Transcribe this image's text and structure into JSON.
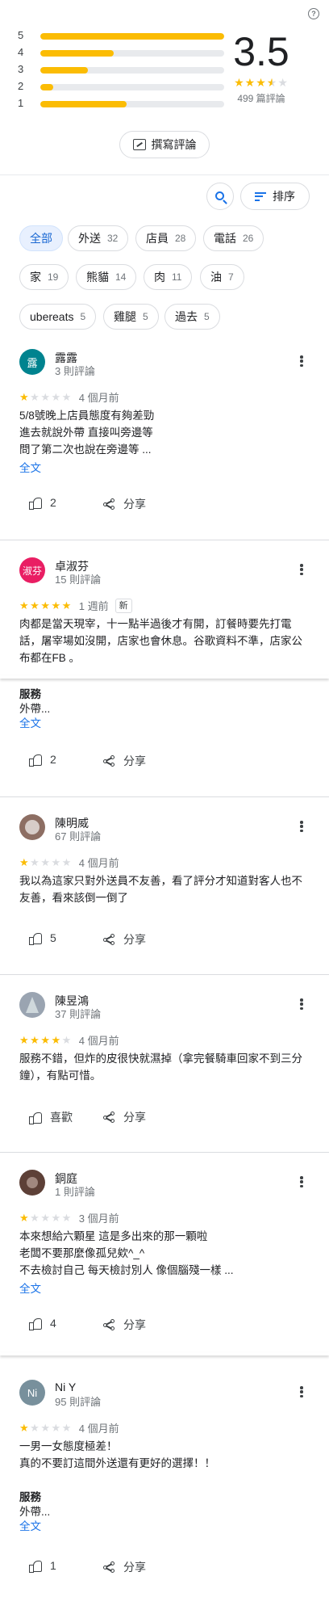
{
  "summary": {
    "rating": "3.5",
    "review_count": "499 篇評論",
    "distribution": [
      {
        "stars": "5",
        "fraction": 1.0
      },
      {
        "stars": "4",
        "fraction": 0.4
      },
      {
        "stars": "3",
        "fraction": 0.26
      },
      {
        "stars": "2",
        "fraction": 0.07
      },
      {
        "stars": "1",
        "fraction": 0.47
      }
    ]
  },
  "write_review_label": "撰寫評論",
  "sort_label": "排序",
  "chips": [
    {
      "label": "全部",
      "count": ""
    },
    {
      "label": "外送",
      "count": "32"
    },
    {
      "label": "店員",
      "count": "28"
    },
    {
      "label": "電話",
      "count": "26"
    },
    {
      "label": "家",
      "count": "19"
    },
    {
      "label": "熊貓",
      "count": "14"
    },
    {
      "label": "肉",
      "count": "11"
    },
    {
      "label": "油",
      "count": "7"
    },
    {
      "label": "ubereats",
      "count": "5"
    },
    {
      "label": "雞腿",
      "count": "5"
    },
    {
      "label": "過去",
      "count": "5"
    }
  ],
  "reviews": [
    {
      "initial": "露",
      "avatar_color": "#00838f",
      "name": "露露",
      "sub": "3 則評論",
      "stars": 1,
      "when": "4 個月前",
      "new": "",
      "text": "5/8號晚上店員態度有夠差勁\n進去就說外帶 直接叫旁邊等\n問了第二次也說在旁邊等 ...",
      "more": "全文",
      "service_h": "",
      "service_v": "",
      "service_more": "",
      "likes": "2",
      "share": "分享"
    },
    {
      "initial": "淑芬",
      "avatar_color": "#e91e63",
      "name": "卓淑芬",
      "sub": "15 則評論",
      "stars": 5,
      "when": "1 週前",
      "new": "新",
      "text": "肉都是當天現宰，十一點半過後才有開，訂餐時要先打電話，屠宰場如沒開，店家也會休息。谷歌資料不準，店家公布都在FB 。",
      "more": "",
      "service_h": "服務",
      "service_v": "外帶...",
      "service_more": "全文",
      "likes": "2",
      "share": "分享"
    },
    {
      "initial": "",
      "avatar_color": "#8d6e63",
      "name": "陳明威",
      "sub": "67 則評論",
      "stars": 1,
      "when": "4 個月前",
      "new": "",
      "text": "我以為這家只對外送員不友善，看了評分才知道對客人也不友善，看來該倒一倒了",
      "more": "",
      "service_h": "",
      "service_v": "",
      "service_more": "",
      "likes": "5",
      "share": "分享"
    },
    {
      "initial": "",
      "avatar_color": "#9aa4b1",
      "name": "陳昱鴻",
      "sub": "37 則評論",
      "stars": 4,
      "when": "4 個月前",
      "new": "",
      "text": "服務不錯，但炸的皮很快就濕掉（拿完餐騎車回家不到三分鐘），有點可惜。",
      "more": "",
      "service_h": "",
      "service_v": "",
      "service_more": "",
      "likes": "喜歡",
      "share": "分享"
    },
    {
      "initial": "",
      "avatar_color": "#5d4037",
      "name": "銅庭",
      "sub": "1 則評論",
      "stars": 1,
      "when": "3 個月前",
      "new": "",
      "text": "本來想給六顆星 這是多出來的那一顆啦\n老闆不要那麼像孤兒欸^_^\n不去檢討自己 每天檢討別人 像個腦殘一樣 ...",
      "more": "全文",
      "service_h": "",
      "service_v": "",
      "service_more": "",
      "likes": "4",
      "share": "分享"
    },
    {
      "initial": "Ni",
      "avatar_color": "#78909c",
      "name": "Ni Y",
      "sub": "95 則評論",
      "stars": 1,
      "when": "4 個月前",
      "new": "",
      "text": "一男一女態度極差！\n真的不要訂這間外送還有更好的選擇！！",
      "more": "",
      "service_h": "服務",
      "service_v": "外帶...",
      "service_more": "全文",
      "likes": "1",
      "share": "分享"
    }
  ]
}
